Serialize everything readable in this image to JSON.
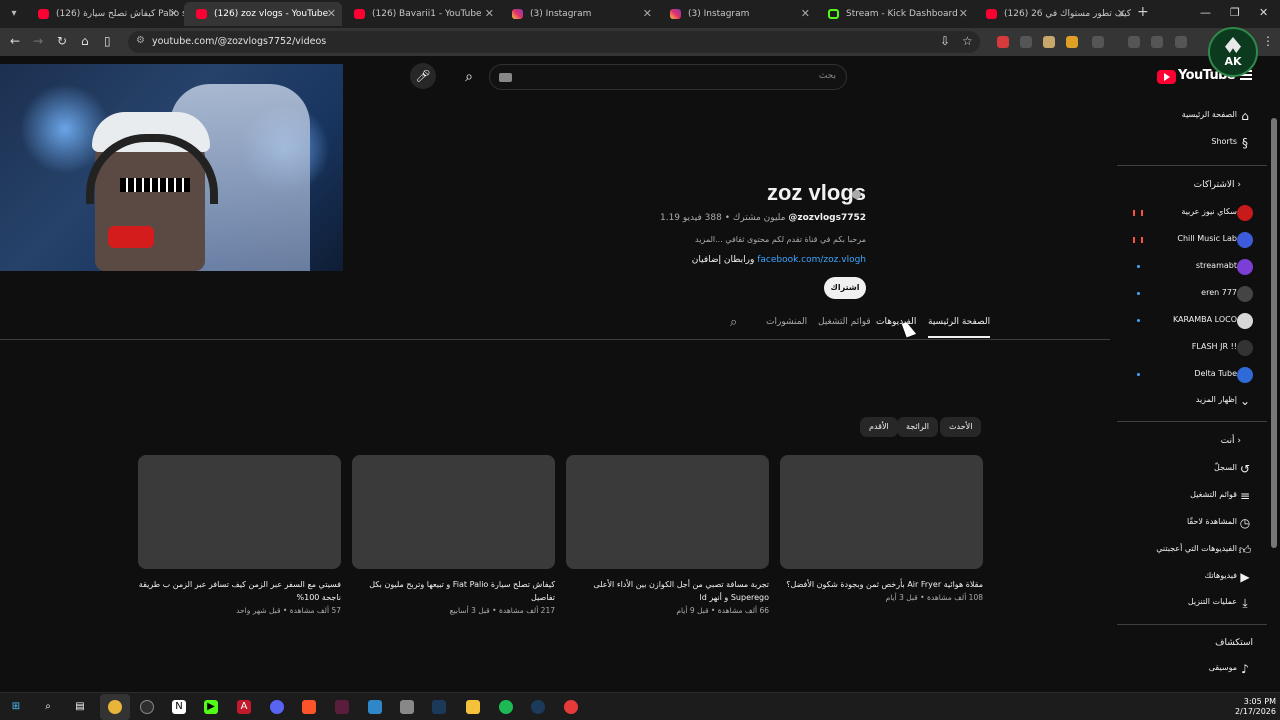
{
  "browser": {
    "tabs": [
      {
        "title": "(126) كيفاش تصلح سيارة Palio st",
        "icon": "youtube",
        "active": false
      },
      {
        "title": "(126) zoz vlogs - YouTube",
        "icon": "youtube",
        "active": true
      },
      {
        "title": "(126) Bavarii1 - YouTube",
        "icon": "youtube",
        "active": false
      },
      {
        "title": "(3) Instagram",
        "icon": "instagram",
        "active": false
      },
      {
        "title": "(3) Instagram",
        "icon": "instagram",
        "active": false
      },
      {
        "title": "Stream - Kick Dashboard",
        "icon": "kick",
        "active": false
      },
      {
        "title": "(126) كيف تطور مستواك في 26",
        "icon": "youtube",
        "active": false
      }
    ],
    "url": "youtube.com/@zozvlogs7752/videos",
    "profile_badge": "AK"
  },
  "masthead": {
    "search_placeholder": "بحث",
    "logo_text": "YouTube"
  },
  "channel": {
    "name": "zoz vlogs",
    "handle": "@zozvlogs7752",
    "stats": "1.19 مليون مشترك • 388 فيديو",
    "description": "مرحبا بكم في قناة تقدم لكم محتوى ثقافي ...المزيد",
    "link": "facebook.com/zoz.vlogh",
    "link_more": "ورابطان إضافيان",
    "subscribe_label": "اشتراك"
  },
  "channel_tabs": {
    "home": "الصفحة الرئيسية",
    "videos": "الفيديوهات",
    "playlists": "قوائم التشغيل",
    "posts": "المنشورات"
  },
  "chips": {
    "latest": "الأحدث",
    "popular": "الرائجة",
    "oldest": "الأقدم"
  },
  "videos": [
    {
      "title": "مقلاة هوائية Air Fryer بأرخص ثمن وبجودة شكون الأفضل؟",
      "meta": "108 ألف مشاهدة • قبل 3 أيام"
    },
    {
      "title": "تجربة مسافة تصبي من أجل الكوازن بين الأداء الأعلى Superego و أنهر ld",
      "meta": "66 ألف مشاهدة • قبل 9 أيام"
    },
    {
      "title": "كيفاش تصلح سيارة Fiat Palio و تبيعها وتربح مليون بكل تفاصيل",
      "meta": "217 ألف مشاهدة • قبل 3 أسابيع"
    },
    {
      "title": "فسيتي مع السفر عبر الزمن كيف تسافر عبر الزمن ب طريقة ناجحة 100%",
      "meta": "57 ألف مشاهدة • قبل شهر واحد"
    }
  ],
  "sidebar": {
    "home": "الصفحة الرئيسية",
    "shorts": "Shorts",
    "subscriptions_header": "الاشتراكات",
    "subscriptions": [
      {
        "name": "سكاي نيوز عربية",
        "indicator": "live",
        "color": "#c71a1a"
      },
      {
        "name": "Chill Music Lab",
        "indicator": "live",
        "color": "#3d5bd9"
      },
      {
        "name": "streamabt",
        "indicator": "new",
        "color": "#7b3fd6"
      },
      {
        "name": "eren 777",
        "indicator": "new",
        "color": "#444444"
      },
      {
        "name": "KARAMBA LOCO",
        "indicator": "new",
        "color": "#d8d8d8"
      },
      {
        "name": "FLASH JR !!",
        "indicator": "none",
        "color": "#333333"
      },
      {
        "name": "Delta Tube",
        "indicator": "new",
        "color": "#2f6ad8"
      }
    ],
    "show_more": "إظهار المزيد",
    "you_header": "أنت",
    "you_items": [
      {
        "label": "السجلّ",
        "icon": "history"
      },
      {
        "label": "قوائم التشغيل",
        "icon": "playlist"
      },
      {
        "label": "المشاهدة لاحقًا",
        "icon": "watch-later"
      },
      {
        "label": "الفيديوهات التي أعجبتني",
        "icon": "like"
      },
      {
        "label": "فيديوهاتك",
        "icon": "your-videos"
      },
      {
        "label": "عمليات التنزيل",
        "icon": "download"
      }
    ],
    "explore_header": "استكشاف",
    "explore_items": [
      {
        "label": "موسيقى",
        "icon": "music"
      }
    ]
  },
  "taskbar": {
    "time": "3:05 PM",
    "date": "2/17/2026"
  }
}
